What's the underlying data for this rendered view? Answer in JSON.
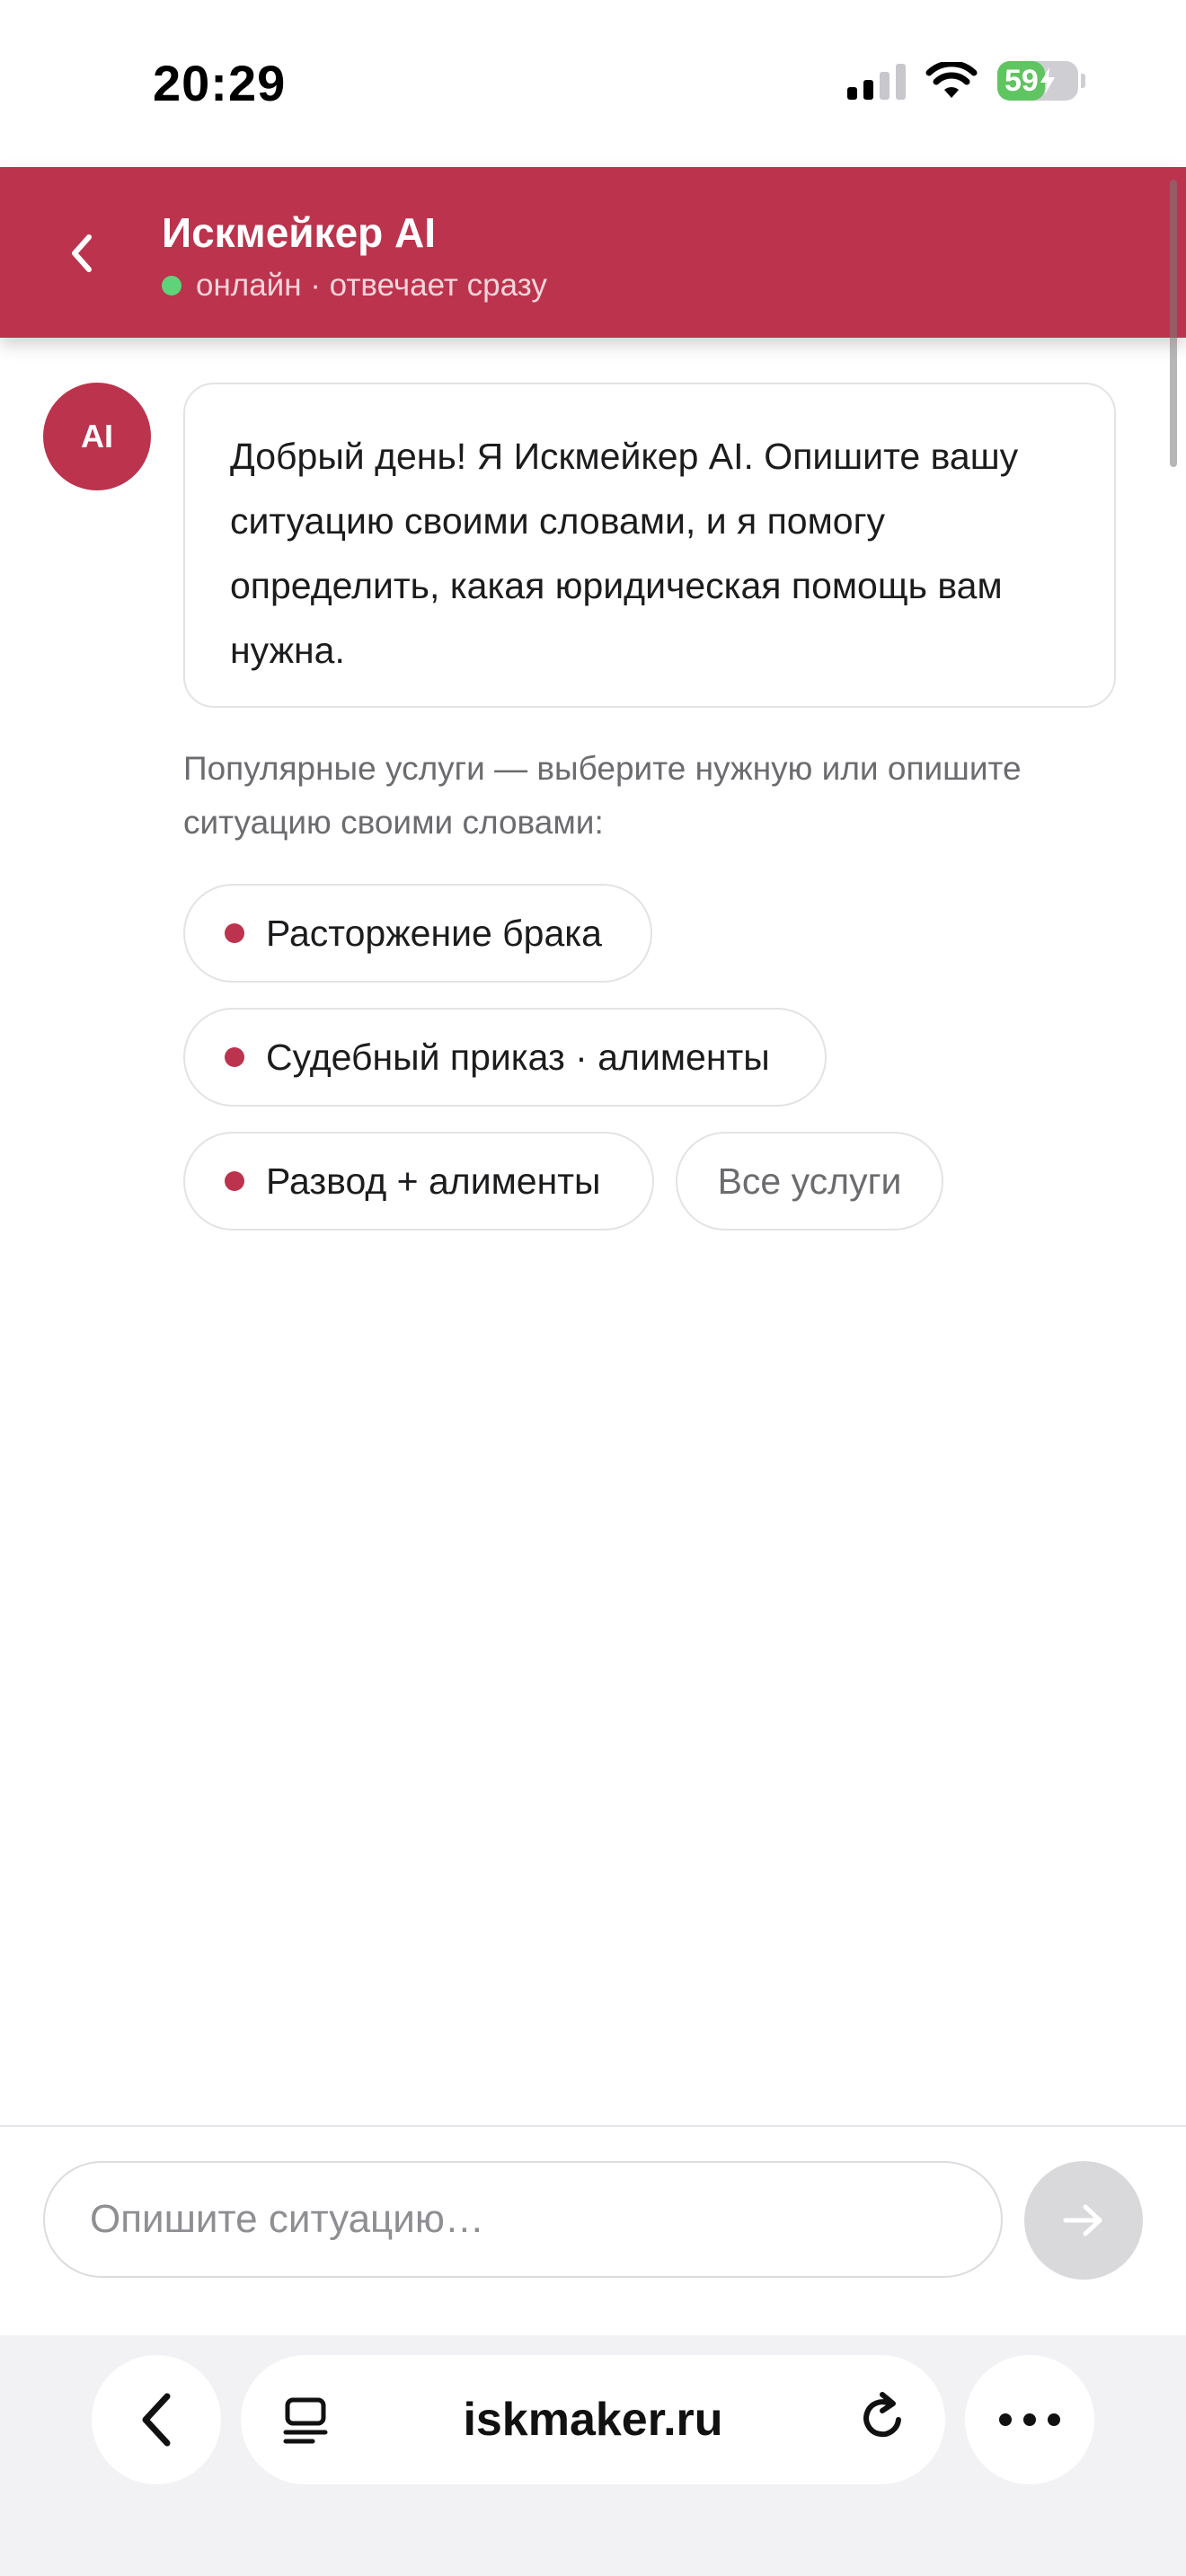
{
  "status_bar": {
    "time": "20:29",
    "battery": "59",
    "battery_level": 0.59
  },
  "header": {
    "title": "Искмейкер AI",
    "status": "онлайн · отвечает сразу"
  },
  "message": {
    "avatar": "AI",
    "text": "Добрый день! Я Искмейкер AI. Опишите вашу ситуацию своими словами, и я помогу определить, какая юридическая помощь вам нужна."
  },
  "services": {
    "hint": "Популярные услуги — выберите нужную или опишите ситуацию своими словами:",
    "chips": [
      {
        "label": "Расторжение брака"
      },
      {
        "label": "Судебный приказ · алименты"
      },
      {
        "label": "Развод + алименты"
      }
    ],
    "all_label": "Все услуги"
  },
  "input": {
    "placeholder": "Опишите ситуацию…"
  },
  "browser": {
    "url": "iskmaker.ru"
  },
  "colors": {
    "accent": "#bc334d",
    "online": "#5fd37a"
  }
}
